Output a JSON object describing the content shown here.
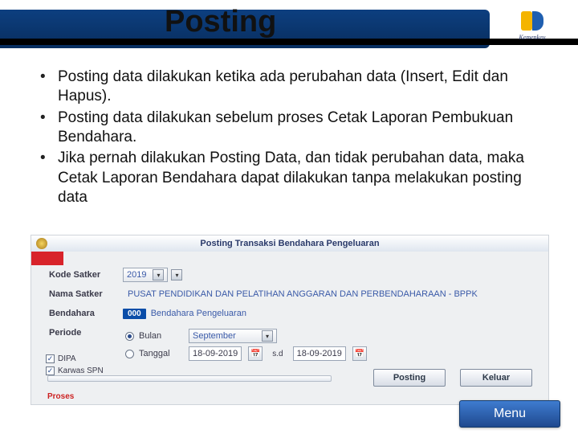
{
  "slide": {
    "title": "Posting",
    "logo_text": "Kemenkeu",
    "bullets": [
      "Posting data dilakukan ketika ada perubahan data (Insert, Edit dan Hapus).",
      "Posting data dilakukan sebelum proses Cetak Laporan Pembukuan Bendahara.",
      "Jika pernah dilakukan Posting Data, dan tidak perubahan data, maka Cetak Laporan Bendahara dapat dilakukan tanpa melakukan posting data"
    ]
  },
  "app": {
    "window_title": "Posting Transaksi Bendahara Pengeluaran",
    "labels": {
      "kode_satker": "Kode Satker",
      "nama_satker": "Nama Satker",
      "bendahara": "Bendahara",
      "periode": "Periode",
      "bulan": "Bulan",
      "tanggal": "Tanggal",
      "sd": "s.d"
    },
    "values": {
      "kode_satker": "2019",
      "nama_satker": "PUSAT PENDIDIKAN DAN PELATIHAN ANGGARAN DAN PERBENDAHARAAN - BPPK",
      "bendahara_code": "000",
      "bendahara_label": "Bendahara Pengeluaran",
      "bulan": "September",
      "tanggal_from": "18-09-2019",
      "tanggal_to": "18-09-2019"
    },
    "checks": {
      "dipa": "DIPA",
      "karwas": "Karwas SPN"
    },
    "buttons": {
      "posting": "Posting",
      "keluar": "Keluar"
    },
    "status": "Proses"
  },
  "footer": {
    "menu": "Menu"
  }
}
